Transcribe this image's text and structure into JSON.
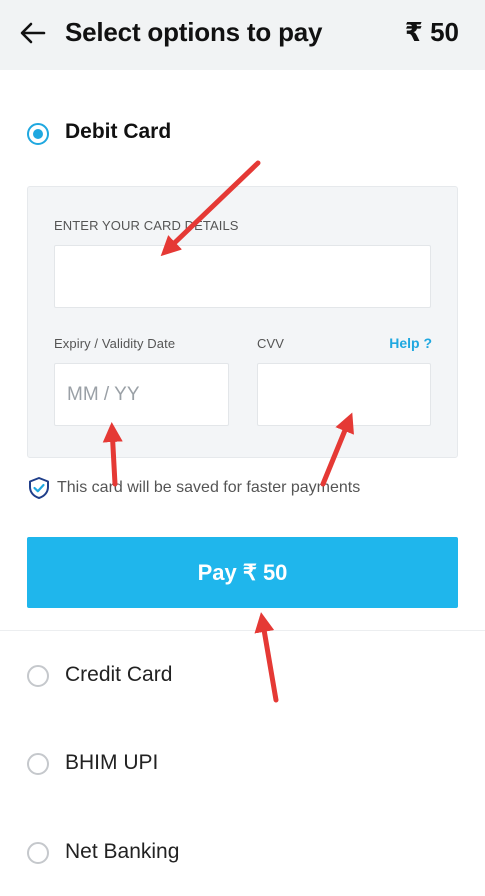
{
  "header": {
    "title": "Select options to pay",
    "amount": "₹ 50"
  },
  "payment_options": {
    "debit_card": {
      "label": "Debit Card",
      "selected": true
    },
    "credit_card": {
      "label": "Credit Card",
      "selected": false
    },
    "bhim_upi": {
      "label": "BHIM UPI",
      "selected": false
    },
    "net_banking": {
      "label": "Net Banking",
      "selected": false
    }
  },
  "card_form": {
    "card_details_label": "ENTER YOUR CARD DETAILS",
    "card_number_value": "",
    "expiry_label": "Expiry / Validity Date",
    "expiry_placeholder": "MM / YY",
    "cvv_label": "CVV",
    "cvv_value": "",
    "help_label": "Help ?"
  },
  "save_note": {
    "text": "This card will be saved for faster payments",
    "icon": "shield-check-icon"
  },
  "pay_button": {
    "label": "Pay ₹ 50"
  },
  "colors": {
    "accent": "#1fa8e0",
    "pay_button": "#1fb6ec",
    "annotation_arrow": "#e53935",
    "header_bg": "#f1f3f4"
  }
}
